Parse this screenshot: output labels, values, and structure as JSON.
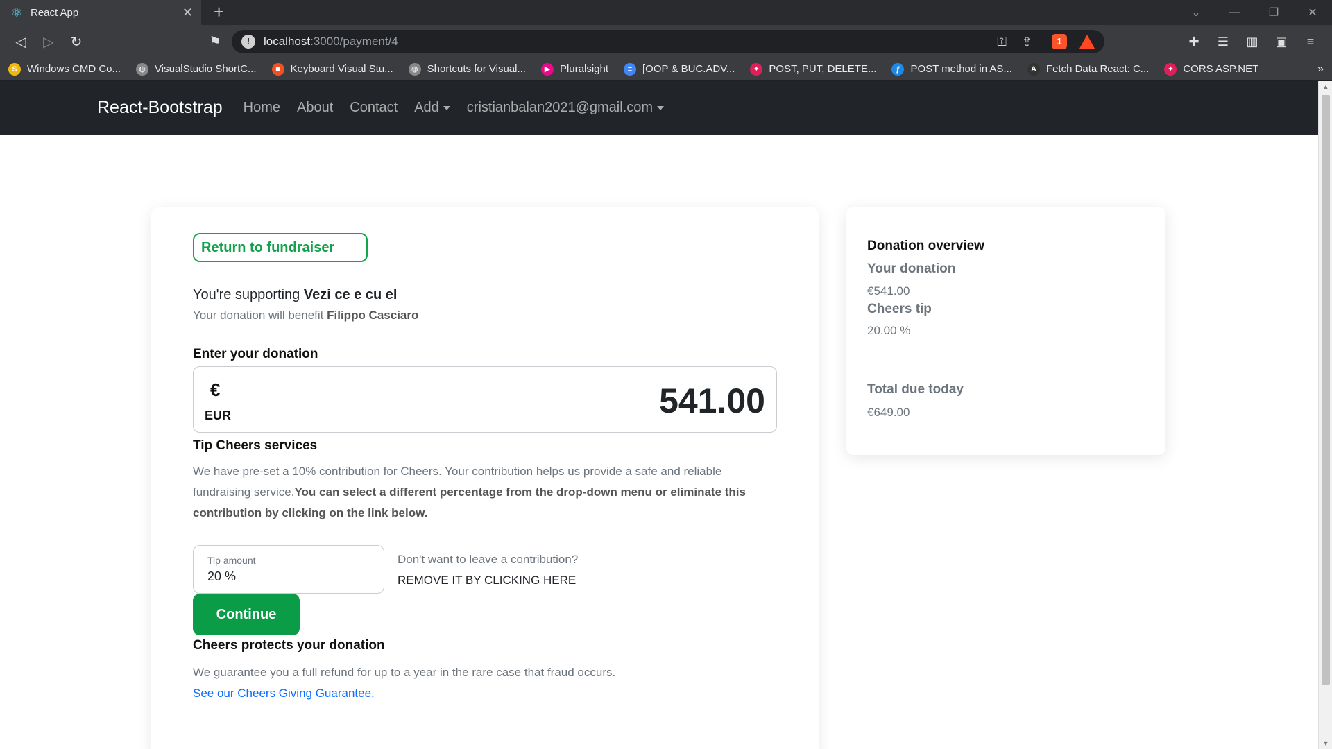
{
  "browser": {
    "tab_title": "React App",
    "tab_close": "✕",
    "new_tab": "+",
    "url_host": "localhost",
    "url_path": ":3000/payment/4",
    "brave_badge": "1",
    "bookmarks": [
      {
        "label": "Windows CMD Co...",
        "icon": "coin-icon",
        "color": "#f0b90b"
      },
      {
        "label": "VisualStudio ShortC...",
        "icon": "globe-icon",
        "color": "#888888"
      },
      {
        "label": "Keyboard Visual Stu...",
        "icon": "microsoft-icon",
        "color": "#f25022"
      },
      {
        "label": "Shortcuts for Visual...",
        "icon": "globe-icon",
        "color": "#888888"
      },
      {
        "label": "Pluralsight",
        "icon": "pluralsight-icon",
        "color": "#e80a89"
      },
      {
        "label": "[OOP & BUC.ADV...",
        "icon": "docs-icon",
        "color": "#4285f4"
      },
      {
        "label": "POST, PUT, DELETE...",
        "icon": "slack-icon",
        "color": "#e01e5a"
      },
      {
        "label": "POST method in AS...",
        "icon": "feather-icon",
        "color": "#1e88e5"
      },
      {
        "label": "Fetch Data React: C...",
        "icon": "angular-icon",
        "color": "#333333"
      },
      {
        "label": "CORS ASP.NET",
        "icon": "slack-icon",
        "color": "#e01e5a"
      }
    ]
  },
  "navbar": {
    "brand": "React-Bootstrap",
    "links": [
      "Home",
      "About",
      "Contact",
      "Add"
    ],
    "user": "cristianbalan2021@gmail.com"
  },
  "donation": {
    "return_label": "Return to fundraiser",
    "supporting_prefix": "You're supporting ",
    "campaign": "Vezi ce e cu el",
    "benefit_prefix": "Your donation will benefit ",
    "beneficiary": "Filippo Casciaro",
    "enter_label": "Enter your donation",
    "currency_symbol": "€",
    "currency_code": "EUR",
    "amount": "541.00",
    "tip_title": "Tip Cheers services",
    "tip_desc_plain": "We have pre-set a 10% contribution for Cheers. Your contribution helps us provide a safe and reliable fundraising service.",
    "tip_desc_bold": "You can select a different percentage from the drop-down menu or eliminate this contribution by clicking on the link below.",
    "tip_field_label": "Tip amount",
    "tip_field_value": "20 %",
    "no_contribution": "Don't want to leave a contribution?",
    "remove_link": "REMOVE IT BY CLICKING HERE",
    "continue_label": "Continue",
    "protect_title": "Cheers protects your donation",
    "protect_desc": "We guarantee you a full refund for up to a year in the rare case that fraud occurs.",
    "protect_link": "See our Cheers Giving Guarantee."
  },
  "overview": {
    "title": "Donation overview",
    "donation_label": "Your donation",
    "donation_value": "€541.00",
    "tip_label": "Cheers tip",
    "tip_value": "20.00 %",
    "total_label": "Total due today",
    "total_value": "€649.00"
  },
  "colors": {
    "accent_green": "#0b9c48",
    "navbar_bg": "#212529",
    "link_blue": "#0d6efd"
  }
}
